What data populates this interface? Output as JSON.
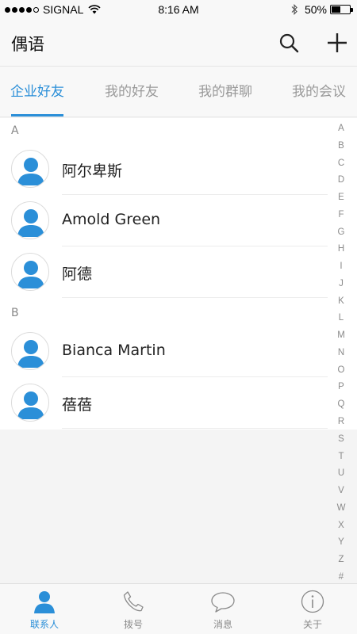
{
  "status_bar": {
    "carrier": "SIGNAL",
    "time": "8:16 AM",
    "battery_percent_text": "50%",
    "battery_level": 0.5
  },
  "header": {
    "title": "偶语",
    "search_icon": "search-icon",
    "add_icon": "plus-icon"
  },
  "tabs": [
    {
      "label": "企业好友",
      "active": true
    },
    {
      "label": "我的好友",
      "active": false
    },
    {
      "label": "我的群聊",
      "active": false
    },
    {
      "label": "我的会议",
      "active": false
    }
  ],
  "contacts": {
    "sections": [
      {
        "letter": "A",
        "items": [
          {
            "name": "阿尔卑斯"
          },
          {
            "name": "Amold Green"
          },
          {
            "name": "阿德"
          }
        ]
      },
      {
        "letter": "B",
        "items": [
          {
            "name": "Bianca Martin"
          },
          {
            "name": "蓓蓓"
          }
        ]
      }
    ]
  },
  "alphabet_index": [
    "A",
    "B",
    "C",
    "D",
    "E",
    "F",
    "G",
    "H",
    "I",
    "J",
    "K",
    "L",
    "M",
    "N",
    "O",
    "P",
    "Q",
    "R",
    "S",
    "T",
    "U",
    "V",
    "W",
    "X",
    "Y",
    "Z",
    "#"
  ],
  "bottom_nav": [
    {
      "label": "联系人",
      "icon": "contacts-icon",
      "active": true
    },
    {
      "label": "拨号",
      "icon": "phone-icon",
      "active": false
    },
    {
      "label": "消息",
      "icon": "message-icon",
      "active": false
    },
    {
      "label": "关于",
      "icon": "info-icon",
      "active": false
    }
  ],
  "colors": {
    "accent": "#2b8fd8",
    "inactive": "#9a9a9a",
    "avatar_blue": "#2b8fd8"
  }
}
